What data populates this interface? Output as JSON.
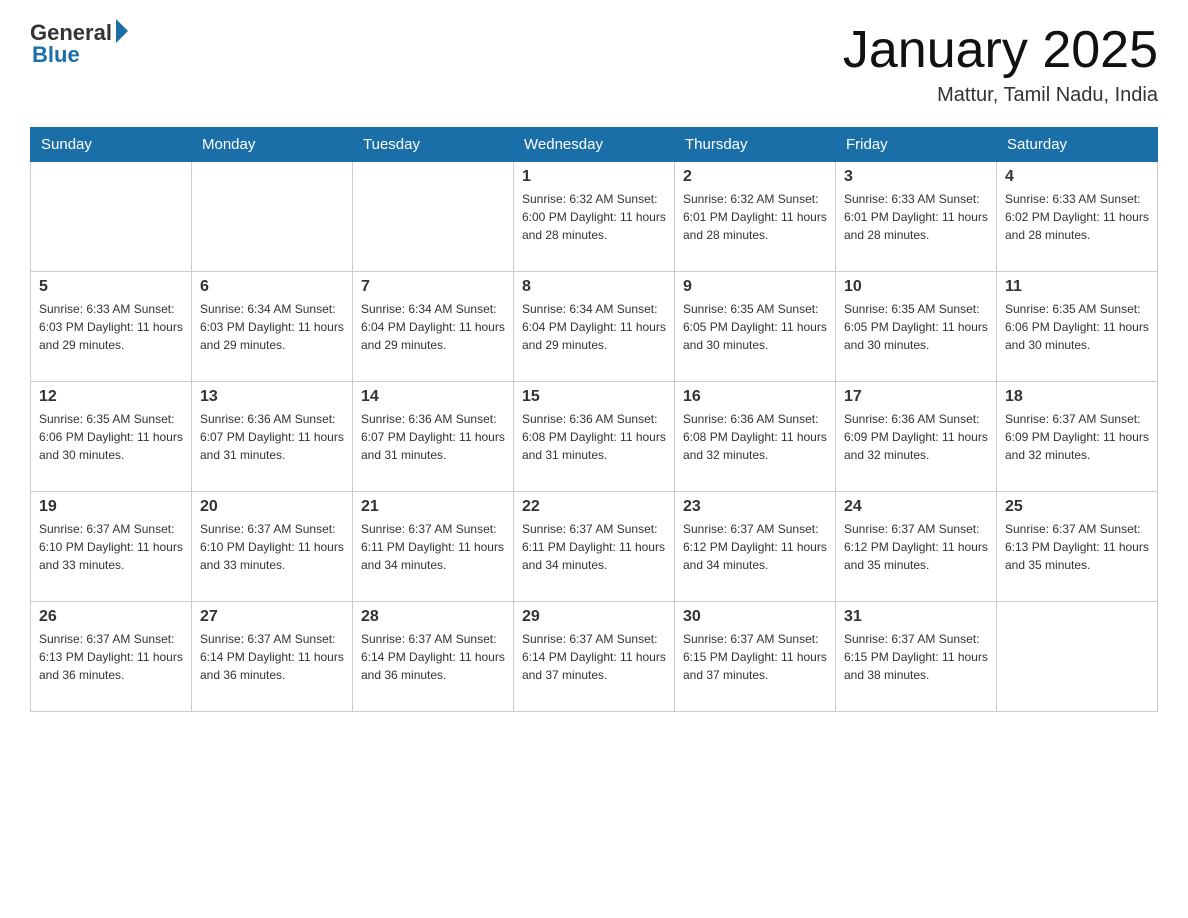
{
  "header": {
    "logo_general": "General",
    "logo_blue": "Blue",
    "month_title": "January 2025",
    "location": "Mattur, Tamil Nadu, India"
  },
  "days_of_week": [
    "Sunday",
    "Monday",
    "Tuesday",
    "Wednesday",
    "Thursday",
    "Friday",
    "Saturday"
  ],
  "weeks": [
    [
      {
        "day": "",
        "info": ""
      },
      {
        "day": "",
        "info": ""
      },
      {
        "day": "",
        "info": ""
      },
      {
        "day": "1",
        "info": "Sunrise: 6:32 AM\nSunset: 6:00 PM\nDaylight: 11 hours and 28 minutes."
      },
      {
        "day": "2",
        "info": "Sunrise: 6:32 AM\nSunset: 6:01 PM\nDaylight: 11 hours and 28 minutes."
      },
      {
        "day": "3",
        "info": "Sunrise: 6:33 AM\nSunset: 6:01 PM\nDaylight: 11 hours and 28 minutes."
      },
      {
        "day": "4",
        "info": "Sunrise: 6:33 AM\nSunset: 6:02 PM\nDaylight: 11 hours and 28 minutes."
      }
    ],
    [
      {
        "day": "5",
        "info": "Sunrise: 6:33 AM\nSunset: 6:03 PM\nDaylight: 11 hours and 29 minutes."
      },
      {
        "day": "6",
        "info": "Sunrise: 6:34 AM\nSunset: 6:03 PM\nDaylight: 11 hours and 29 minutes."
      },
      {
        "day": "7",
        "info": "Sunrise: 6:34 AM\nSunset: 6:04 PM\nDaylight: 11 hours and 29 minutes."
      },
      {
        "day": "8",
        "info": "Sunrise: 6:34 AM\nSunset: 6:04 PM\nDaylight: 11 hours and 29 minutes."
      },
      {
        "day": "9",
        "info": "Sunrise: 6:35 AM\nSunset: 6:05 PM\nDaylight: 11 hours and 30 minutes."
      },
      {
        "day": "10",
        "info": "Sunrise: 6:35 AM\nSunset: 6:05 PM\nDaylight: 11 hours and 30 minutes."
      },
      {
        "day": "11",
        "info": "Sunrise: 6:35 AM\nSunset: 6:06 PM\nDaylight: 11 hours and 30 minutes."
      }
    ],
    [
      {
        "day": "12",
        "info": "Sunrise: 6:35 AM\nSunset: 6:06 PM\nDaylight: 11 hours and 30 minutes."
      },
      {
        "day": "13",
        "info": "Sunrise: 6:36 AM\nSunset: 6:07 PM\nDaylight: 11 hours and 31 minutes."
      },
      {
        "day": "14",
        "info": "Sunrise: 6:36 AM\nSunset: 6:07 PM\nDaylight: 11 hours and 31 minutes."
      },
      {
        "day": "15",
        "info": "Sunrise: 6:36 AM\nSunset: 6:08 PM\nDaylight: 11 hours and 31 minutes."
      },
      {
        "day": "16",
        "info": "Sunrise: 6:36 AM\nSunset: 6:08 PM\nDaylight: 11 hours and 32 minutes."
      },
      {
        "day": "17",
        "info": "Sunrise: 6:36 AM\nSunset: 6:09 PM\nDaylight: 11 hours and 32 minutes."
      },
      {
        "day": "18",
        "info": "Sunrise: 6:37 AM\nSunset: 6:09 PM\nDaylight: 11 hours and 32 minutes."
      }
    ],
    [
      {
        "day": "19",
        "info": "Sunrise: 6:37 AM\nSunset: 6:10 PM\nDaylight: 11 hours and 33 minutes."
      },
      {
        "day": "20",
        "info": "Sunrise: 6:37 AM\nSunset: 6:10 PM\nDaylight: 11 hours and 33 minutes."
      },
      {
        "day": "21",
        "info": "Sunrise: 6:37 AM\nSunset: 6:11 PM\nDaylight: 11 hours and 34 minutes."
      },
      {
        "day": "22",
        "info": "Sunrise: 6:37 AM\nSunset: 6:11 PM\nDaylight: 11 hours and 34 minutes."
      },
      {
        "day": "23",
        "info": "Sunrise: 6:37 AM\nSunset: 6:12 PM\nDaylight: 11 hours and 34 minutes."
      },
      {
        "day": "24",
        "info": "Sunrise: 6:37 AM\nSunset: 6:12 PM\nDaylight: 11 hours and 35 minutes."
      },
      {
        "day": "25",
        "info": "Sunrise: 6:37 AM\nSunset: 6:13 PM\nDaylight: 11 hours and 35 minutes."
      }
    ],
    [
      {
        "day": "26",
        "info": "Sunrise: 6:37 AM\nSunset: 6:13 PM\nDaylight: 11 hours and 36 minutes."
      },
      {
        "day": "27",
        "info": "Sunrise: 6:37 AM\nSunset: 6:14 PM\nDaylight: 11 hours and 36 minutes."
      },
      {
        "day": "28",
        "info": "Sunrise: 6:37 AM\nSunset: 6:14 PM\nDaylight: 11 hours and 36 minutes."
      },
      {
        "day": "29",
        "info": "Sunrise: 6:37 AM\nSunset: 6:14 PM\nDaylight: 11 hours and 37 minutes."
      },
      {
        "day": "30",
        "info": "Sunrise: 6:37 AM\nSunset: 6:15 PM\nDaylight: 11 hours and 37 minutes."
      },
      {
        "day": "31",
        "info": "Sunrise: 6:37 AM\nSunset: 6:15 PM\nDaylight: 11 hours and 38 minutes."
      },
      {
        "day": "",
        "info": ""
      }
    ]
  ]
}
